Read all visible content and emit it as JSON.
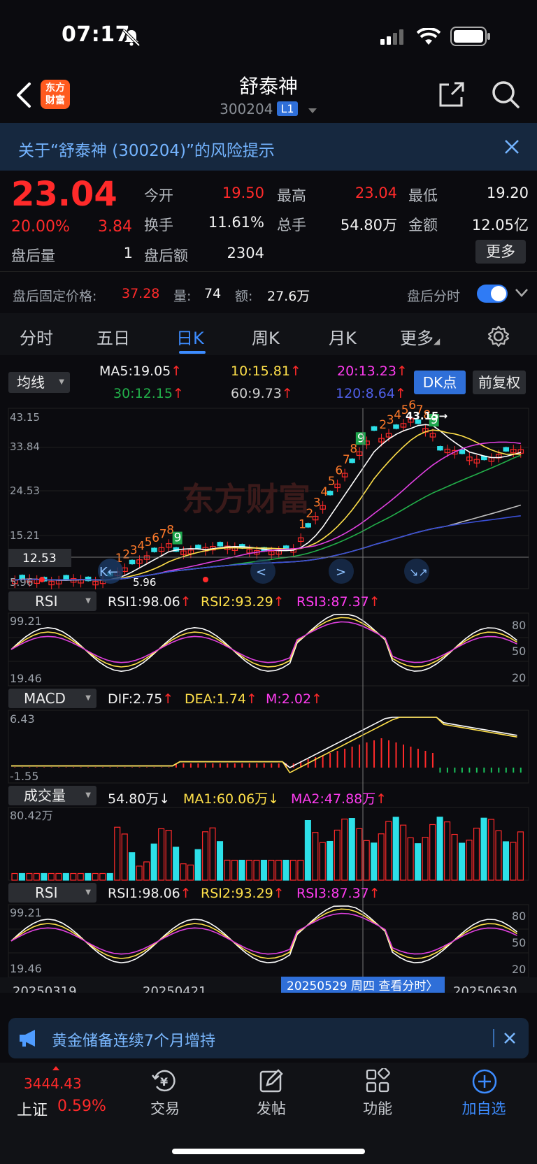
{
  "status_bar": {
    "time": "07:17"
  },
  "header": {
    "logo_line1": "东方",
    "logo_line2": "财富",
    "title": "舒泰神",
    "code": "300204",
    "level_badge": "L1"
  },
  "risk_banner": {
    "text": "关于“舒泰神 (300204)”的风险提示"
  },
  "quote": {
    "price": "23.04",
    "change_pct": "20.00%",
    "change_amt": "3.84",
    "fields": [
      {
        "label": "今开",
        "value": "19.50"
      },
      {
        "label": "最高",
        "value": "23.04"
      },
      {
        "label": "最低",
        "value": "19.20"
      },
      {
        "label": "换手",
        "value": "11.61%"
      },
      {
        "label": "总手",
        "value": "54.80万"
      },
      {
        "label": "金额",
        "value": "12.05亿"
      },
      {
        "label": "盘后量",
        "value": "1"
      },
      {
        "label": "盘后额",
        "value": "2304"
      }
    ],
    "more": "更多"
  },
  "after_hours": {
    "fixed_price_label": "盘后固定价格:",
    "fixed_price": "37.28",
    "vol_label": "量:",
    "vol": "74",
    "amt_label": "额:",
    "amt": "27.6万",
    "toggle_label": "盘后分时"
  },
  "tabs": [
    "分时",
    "五日",
    "日K",
    "周K",
    "月K",
    "更多"
  ],
  "ma_panel": {
    "selector": "均线",
    "ma5": "MA5:19.05",
    "ma10": "10:15.81",
    "ma20": "20:13.23",
    "ma30": "30:12.15",
    "ma60": "60:9.73",
    "ma120": "120:8.64",
    "dk_button": "DK点",
    "fq_button": "前复权"
  },
  "colors": {
    "up": "#ff2a2a",
    "down": "#2de0e8",
    "ma5": "#ffffff",
    "ma10": "#ffe04a",
    "ma20": "#e040e0",
    "ma30": "#22b04a",
    "ma60": "#bfbfbf",
    "ma120": "#3a4fd6",
    "accent": "#3d8cff"
  },
  "kline": {
    "y_labels": [
      "43.15",
      "33.84",
      "24.53",
      "15.21"
    ],
    "crosshair_price": "12.53",
    "max_marker": "43.15",
    "low_price": "5.96",
    "left_marker": "5.96",
    "watermark": "东方财富",
    "td_labels": [
      "1",
      "2",
      "3",
      "4",
      "5",
      "6",
      "7",
      "8",
      "9",
      "1",
      "2",
      "3",
      "4",
      "5",
      "6",
      "7",
      "8",
      "9",
      "2",
      "3",
      "4",
      "5",
      "6",
      "7",
      "8",
      "9"
    ]
  },
  "rsi_panel": {
    "selector": "RSI",
    "rsi1": "RSI1:98.06",
    "rsi2": "RSI2:93.29",
    "rsi3": "RSI3:87.37",
    "y_top": "99.21",
    "y_bottom": "19.46",
    "levels": [
      "80",
      "50",
      "20"
    ]
  },
  "macd_panel": {
    "selector": "MACD",
    "dif": "DIF:2.75",
    "dea": "DEA:1.74",
    "m": "M:2.02",
    "y_top": "6.43",
    "y_bottom": "-1.55"
  },
  "volume_panel": {
    "selector": "成交量",
    "vol": "54.80万",
    "ma1": "MA1:60.06万",
    "ma2": "MA2:47.88万",
    "y_top": "80.42万"
  },
  "x_axis": {
    "dates": [
      "20250319",
      "20250421",
      "20250630"
    ],
    "crosshair_date": "20250529 周四 查看分时"
  },
  "news": {
    "text": "黄金储备连续7个月增持"
  },
  "bottom_nav": {
    "index_value": "3444.43",
    "index_name": "上证",
    "index_change": "0.59%",
    "items": [
      "交易",
      "发帖",
      "功能",
      "加自选"
    ]
  }
}
